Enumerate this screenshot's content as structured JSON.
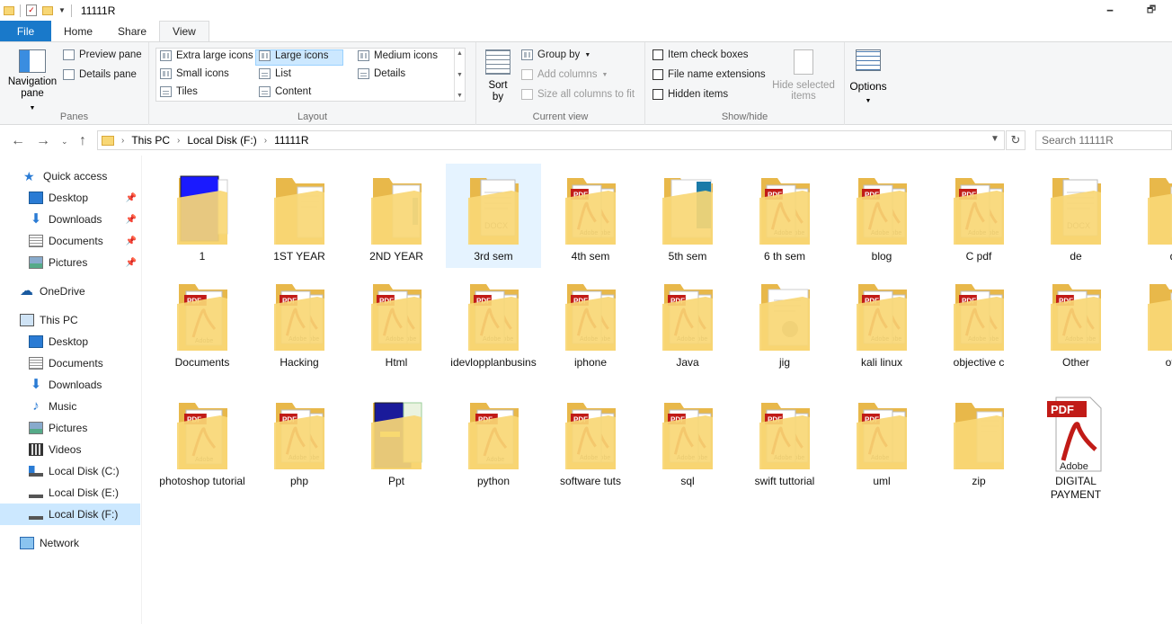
{
  "window": {
    "title": "11111R",
    "controls": {
      "minimize": "🗕",
      "maximize": "🗗"
    }
  },
  "ribbon_tabs": [
    {
      "label": "File"
    },
    {
      "label": "Home"
    },
    {
      "label": "Share"
    },
    {
      "label": "View"
    }
  ],
  "ribbon": {
    "panes": {
      "label": "Panes",
      "navigation_pane": "Navigation pane",
      "preview_pane": "Preview pane",
      "details_pane": "Details pane"
    },
    "layout": {
      "label": "Layout",
      "options": [
        "Extra large icons",
        "Large icons",
        "Medium icons",
        "Small icons",
        "List",
        "Details",
        "Tiles",
        "Content"
      ],
      "selected": "Large icons"
    },
    "current_view": {
      "label": "Current view",
      "sort_by": "Sort by",
      "group_by": "Group by",
      "add_columns": "Add columns",
      "size_columns": "Size all columns to fit"
    },
    "show_hide": {
      "label": "Show/hide",
      "item_check_boxes": "Item check boxes",
      "file_name_extensions": "File name extensions",
      "hidden_items": "Hidden items",
      "hide_selected": "Hide selected items"
    },
    "options": {
      "label": "Options"
    }
  },
  "address": {
    "crumbs": [
      "This PC",
      "Local Disk (F:)",
      "11111R"
    ],
    "search_placeholder": "Search 11111R"
  },
  "nav": {
    "quick_access": "Quick access",
    "quick_items": [
      "Desktop",
      "Downloads",
      "Documents",
      "Pictures"
    ],
    "onedrive": "OneDrive",
    "this_pc": "This PC",
    "pc_items": [
      "Desktop",
      "Documents",
      "Downloads",
      "Music",
      "Pictures",
      "Videos",
      "Local Disk (C:)",
      "Local Disk (E:)",
      "Local Disk (F:)"
    ],
    "network": "Network",
    "selected": "Local Disk (F:)"
  },
  "colors": {
    "file_tab": "#1979ca",
    "selection": "#cce8ff",
    "folder": "#f8d775",
    "folder_dark": "#e8b84a",
    "pdf_red": "#c11b17"
  },
  "items": [
    {
      "name": "1",
      "thumb": "blue-doc"
    },
    {
      "name": "1ST YEAR",
      "thumb": "doc"
    },
    {
      "name": "2ND YEAR",
      "thumb": "doc-blue"
    },
    {
      "name": "3rd sem",
      "thumb": "docx",
      "selected": true
    },
    {
      "name": "4th sem",
      "thumb": "pdf"
    },
    {
      "name": "5th sem",
      "thumb": "doc-teal"
    },
    {
      "name": "6 th sem",
      "thumb": "pdf"
    },
    {
      "name": "blog",
      "thumb": "pdf"
    },
    {
      "name": "C pdf",
      "thumb": "pdf"
    },
    {
      "name": "de",
      "thumb": "docx"
    },
    {
      "name": "d",
      "thumb": "doc"
    },
    {
      "name": "Documents",
      "thumb": "pdf-single"
    },
    {
      "name": "Hacking",
      "thumb": "pdf"
    },
    {
      "name": "Html",
      "thumb": "pdf"
    },
    {
      "name": "idevlopplanbusins",
      "thumb": "pdf"
    },
    {
      "name": "iphone",
      "thumb": "pdf"
    },
    {
      "name": "Java",
      "thumb": "pdf"
    },
    {
      "name": "jig",
      "thumb": "doc-chart"
    },
    {
      "name": "kali linux",
      "thumb": "pdf"
    },
    {
      "name": "objective c",
      "thumb": "pdf"
    },
    {
      "name": "Other",
      "thumb": "pdf"
    },
    {
      "name": "oth",
      "thumb": "doc"
    },
    {
      "name": "photoshop tutorial",
      "thumb": "pdf-single"
    },
    {
      "name": "php",
      "thumb": "pdf"
    },
    {
      "name": "Ppt",
      "thumb": "ppt"
    },
    {
      "name": "python",
      "thumb": "pdf-single"
    },
    {
      "name": "software tuts",
      "thumb": "pdf"
    },
    {
      "name": "sql",
      "thumb": "pdf"
    },
    {
      "name": "swift tuttorial",
      "thumb": "pdf"
    },
    {
      "name": "uml",
      "thumb": "pdf-doc"
    },
    {
      "name": "zip",
      "thumb": "doc"
    },
    {
      "name": "DIGITAL PAYMENT",
      "thumb": "pdf-file"
    }
  ],
  "icon_text": {
    "pdf": "PDF",
    "adobe": "Adobe",
    "docx": "DOCX"
  }
}
